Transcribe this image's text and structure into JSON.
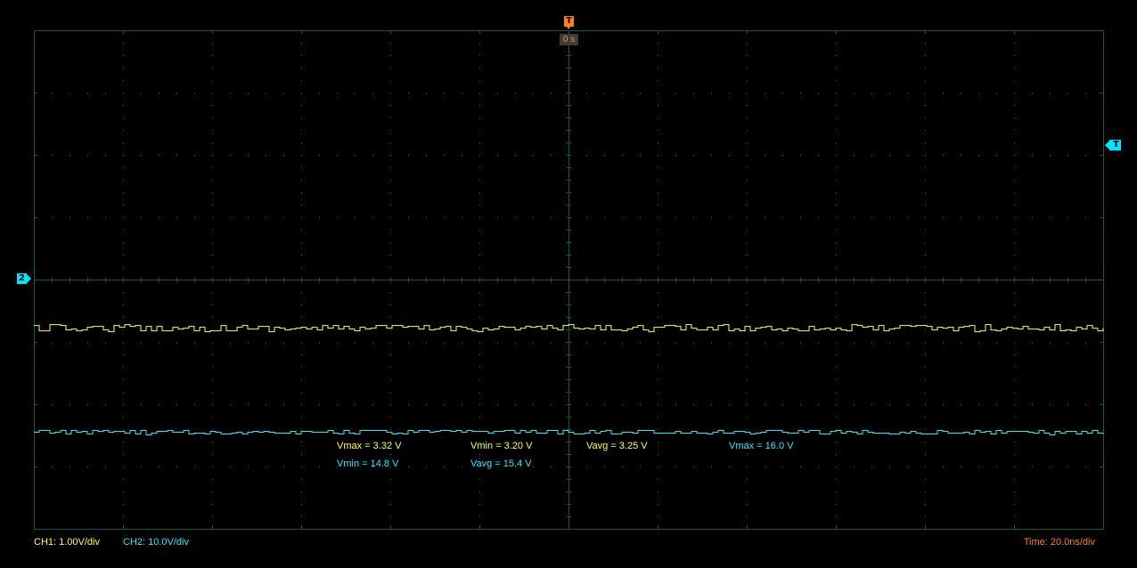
{
  "colors": {
    "background": "#000000",
    "grid": "#0f5a47",
    "grid_dots": "#2f6e5c",
    "ch1": "#ffff4d",
    "ch2": "#33e6ff",
    "trigger": "#ff7f1f",
    "time_readout": "#ff8a2a"
  },
  "trigger": {
    "time_marker_label": "T",
    "time_readout": "0 s",
    "level_marker_label": "T"
  },
  "ch2_marker_label": "2",
  "measurements": {
    "ch1_vmax": "Vmax = 3.32 V",
    "ch1_vmin": "Vmin = 3.20 V",
    "ch1_vavg": "Vavg = 3.25 V",
    "ch2_vmax": "Vmax = 16.0 V",
    "ch2_vmin": "Vmin = 14.8 V",
    "ch2_vavg": "Vavg = 15.4 V"
  },
  "status": {
    "ch1_scale": "CH1: 1.00V/div",
    "ch2_scale": "CH2: 10.0V/div",
    "timebase": "Time: 20.0ns/div"
  },
  "waveforms": {
    "divisions_horizontal": 12,
    "divisions_vertical": 8,
    "ch1_level_div": 3.22,
    "ch1_noise_div": 0.06,
    "ch2_level_div": 1.55,
    "ch2_noise_div": 0.04
  }
}
